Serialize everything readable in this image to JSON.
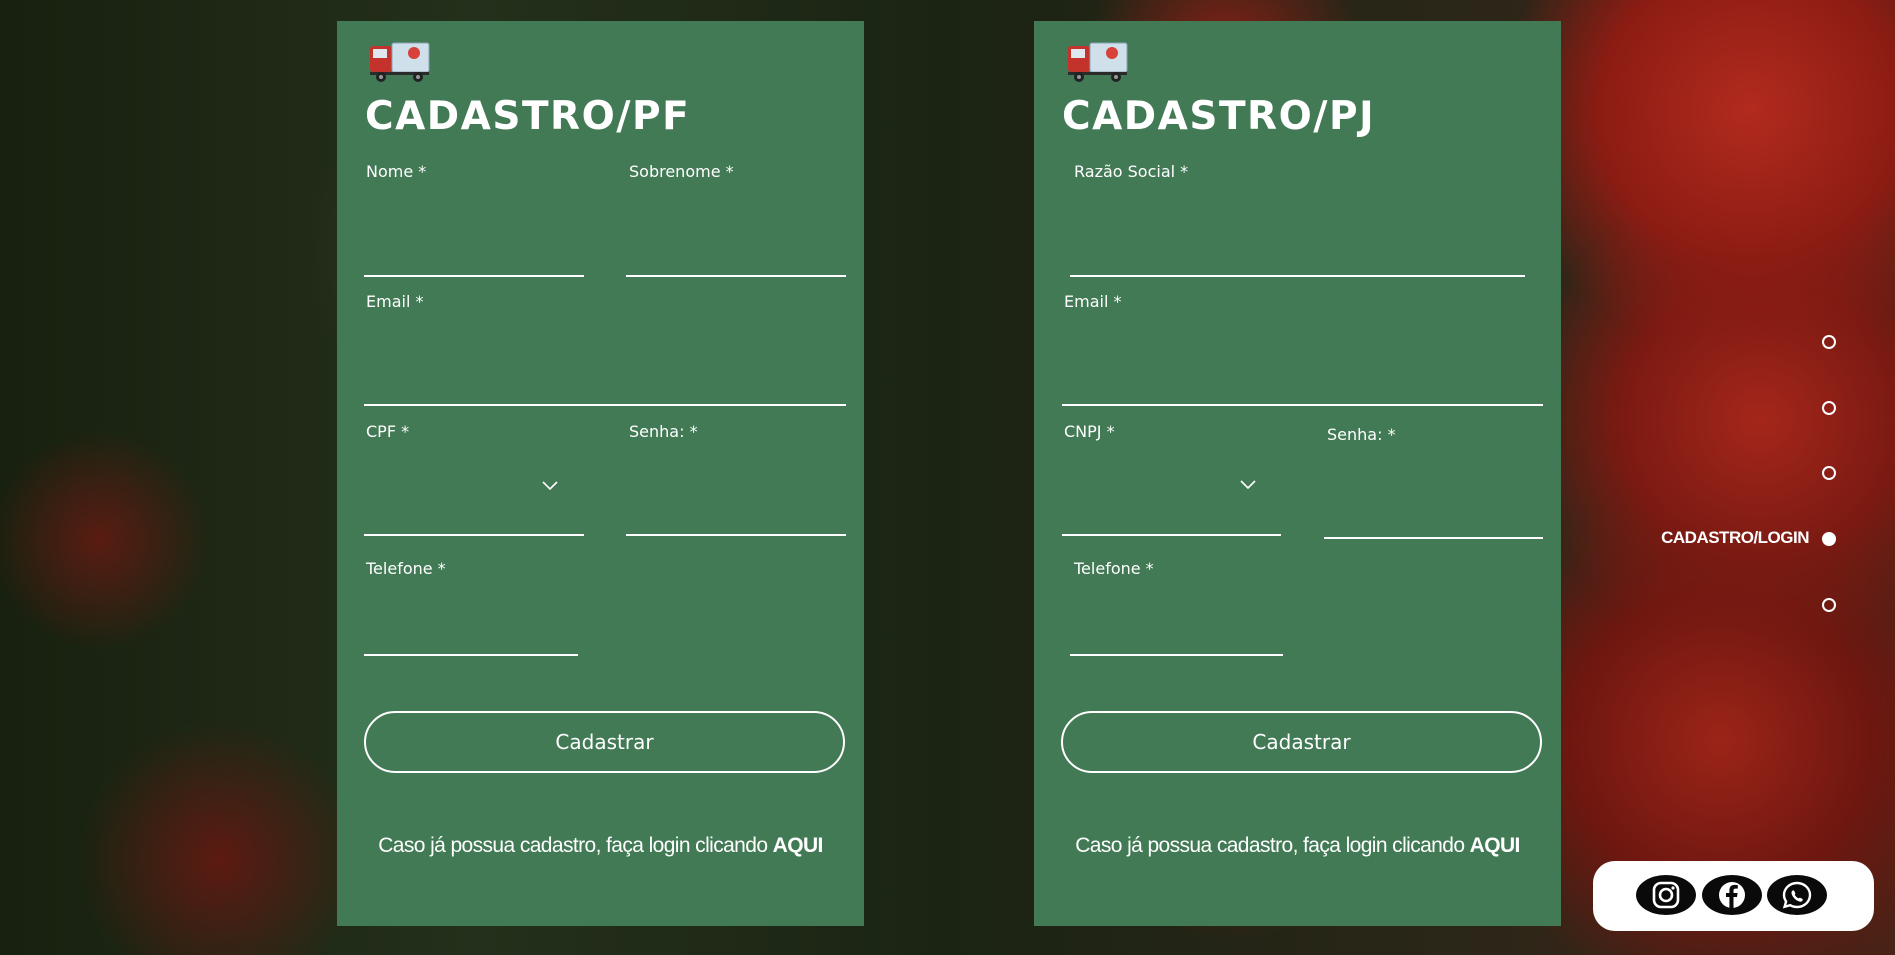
{
  "forms": {
    "pf": {
      "title": "CADASTRO/PF",
      "nome_label": "Nome *",
      "sobrenome_label": "Sobrenome *",
      "email_label": "Email *",
      "cpf_label": "CPF *",
      "senha_label": "Senha: *",
      "telefone_label": "Telefone *",
      "submit_label": "Cadastrar",
      "login_prompt": "Caso já possua cadastro, faça login clicando ",
      "login_link": "AQUI"
    },
    "pj": {
      "title": "CADASTRO/PJ",
      "razao_label": "Razão Social *",
      "email_label": "Email *",
      "cnpj_label": "CNPJ *",
      "senha_label": "Senha: *",
      "telefone_label": "Telefone *",
      "submit_label": "Cadastrar",
      "login_prompt": "Caso já possua cadastro, faça login clicando ",
      "login_link": "AQUI"
    }
  },
  "side_nav": {
    "active_label": "CADASTRO/LOGIN",
    "items": [
      "section-1",
      "section-2",
      "section-3",
      "cadastro-login",
      "section-5"
    ],
    "active_index": 3
  },
  "social": {
    "icons": [
      "instagram-icon",
      "facebook-icon",
      "whatsapp-icon"
    ]
  },
  "colors": {
    "card_bg": "#427a56",
    "text": "#ffffff",
    "social_bg": "#ffffff",
    "icon_bg": "#0a0a0a"
  }
}
